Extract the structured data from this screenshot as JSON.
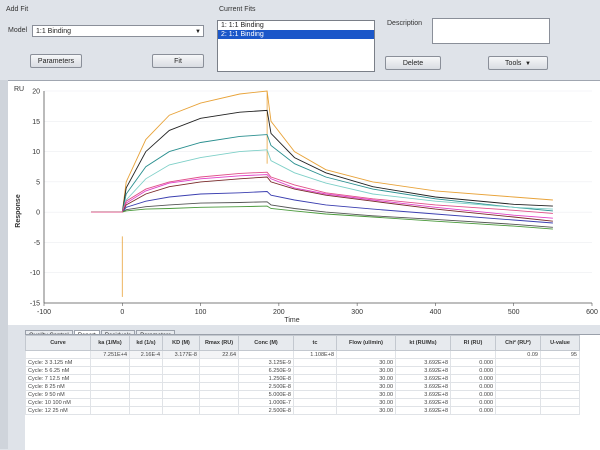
{
  "fit": {
    "add_fit_label": "Add Fit",
    "model_label": "Model",
    "model_value": "1:1 Binding",
    "parameters_button": "Parameters",
    "fit_button": "Fit"
  },
  "current_fits": {
    "title": "Current Fits",
    "items": [
      {
        "label": "1: 1:1 Binding",
        "selected": false
      },
      {
        "label": "2: 1:1 Binding",
        "selected": true
      }
    ],
    "delete_button": "Delete"
  },
  "description": {
    "label": "Description",
    "value": ""
  },
  "tools_button": "Tools",
  "chart_data": {
    "type": "line",
    "ylabel": "Response",
    "xlabel": "Time",
    "unit_label": "RU",
    "xlim": [
      -100,
      600
    ],
    "ylim": [
      -15,
      20
    ],
    "x_ticks": [
      -100,
      0,
      100,
      200,
      300,
      400,
      500,
      600
    ],
    "y_ticks": [
      -15,
      -10,
      -5,
      0,
      5,
      10,
      15,
      20
    ],
    "series": [
      {
        "color": "#e8a33a",
        "points": [
          [
            -40,
            0
          ],
          [
            0,
            0
          ],
          [
            5,
            5
          ],
          [
            30,
            12
          ],
          [
            60,
            16
          ],
          [
            100,
            18
          ],
          [
            150,
            19.5
          ],
          [
            185,
            20
          ],
          [
            190,
            15
          ],
          [
            220,
            10
          ],
          [
            260,
            7
          ],
          [
            320,
            5
          ],
          [
            400,
            3.5
          ],
          [
            500,
            2.5
          ],
          [
            550,
            2
          ]
        ]
      },
      {
        "color": "#222222",
        "points": [
          [
            -40,
            0
          ],
          [
            0,
            0
          ],
          [
            5,
            4
          ],
          [
            30,
            10
          ],
          [
            60,
            13.5
          ],
          [
            100,
            15.5
          ],
          [
            150,
            16.5
          ],
          [
            185,
            16.8
          ],
          [
            190,
            13
          ],
          [
            220,
            9
          ],
          [
            260,
            6.5
          ],
          [
            320,
            4.2
          ],
          [
            400,
            2.5
          ],
          [
            500,
            1.3
          ],
          [
            550,
            1
          ]
        ]
      },
      {
        "color": "#2a8f8f",
        "points": [
          [
            -40,
            0
          ],
          [
            0,
            0
          ],
          [
            5,
            3
          ],
          [
            30,
            7.5
          ],
          [
            60,
            10
          ],
          [
            100,
            11.5
          ],
          [
            150,
            12.5
          ],
          [
            185,
            12.8
          ],
          [
            190,
            11
          ],
          [
            220,
            8
          ],
          [
            260,
            5.8
          ],
          [
            320,
            3.8
          ],
          [
            400,
            2.2
          ],
          [
            500,
            0.8
          ],
          [
            550,
            0.2
          ]
        ]
      },
      {
        "color": "#7fd0c8",
        "points": [
          [
            -40,
            0
          ],
          [
            0,
            0
          ],
          [
            5,
            2
          ],
          [
            30,
            5.5
          ],
          [
            60,
            7.8
          ],
          [
            100,
            9
          ],
          [
            150,
            10
          ],
          [
            185,
            10.3
          ],
          [
            190,
            8.5
          ],
          [
            220,
            6.5
          ],
          [
            260,
            4.8
          ],
          [
            320,
            3
          ],
          [
            400,
            1.8
          ],
          [
            500,
            0.8
          ],
          [
            550,
            0.5
          ]
        ]
      },
      {
        "color": "#e040c8",
        "points": [
          [
            -40,
            0
          ],
          [
            0,
            0
          ],
          [
            5,
            1.5
          ],
          [
            30,
            3.5
          ],
          [
            60,
            4.8
          ],
          [
            100,
            5.5
          ],
          [
            150,
            6
          ],
          [
            185,
            6.2
          ],
          [
            190,
            5.5
          ],
          [
            220,
            4
          ],
          [
            260,
            3
          ],
          [
            320,
            2
          ],
          [
            400,
            0.8
          ],
          [
            500,
            -0.5
          ],
          [
            550,
            -1
          ]
        ]
      },
      {
        "color": "#7a2a2a",
        "points": [
          [
            -40,
            0
          ],
          [
            0,
            0
          ],
          [
            5,
            1.2
          ],
          [
            30,
            3
          ],
          [
            60,
            4.2
          ],
          [
            100,
            5
          ],
          [
            150,
            5.5
          ],
          [
            185,
            5.8
          ],
          [
            190,
            5
          ],
          [
            220,
            3.8
          ],
          [
            260,
            2.8
          ],
          [
            320,
            1.8
          ],
          [
            400,
            0.5
          ],
          [
            500,
            -0.8
          ],
          [
            550,
            -1.5
          ]
        ]
      },
      {
        "color": "#3b3fb0",
        "points": [
          [
            -40,
            0
          ],
          [
            0,
            0
          ],
          [
            5,
            0.8
          ],
          [
            30,
            1.8
          ],
          [
            60,
            2.5
          ],
          [
            100,
            3
          ],
          [
            150,
            3.2
          ],
          [
            185,
            3.4
          ],
          [
            190,
            2.8
          ],
          [
            220,
            2
          ],
          [
            260,
            1.2
          ],
          [
            320,
            0.5
          ],
          [
            400,
            -0.3
          ],
          [
            500,
            -1.3
          ],
          [
            550,
            -1.8
          ]
        ]
      },
      {
        "color": "#555555",
        "points": [
          [
            -40,
            0
          ],
          [
            0,
            0
          ],
          [
            5,
            0.4
          ],
          [
            30,
            0.9
          ],
          [
            60,
            1.2
          ],
          [
            100,
            1.5
          ],
          [
            150,
            1.6
          ],
          [
            185,
            1.7
          ],
          [
            190,
            1.2
          ],
          [
            220,
            0.6
          ],
          [
            260,
            0
          ],
          [
            320,
            -0.6
          ],
          [
            400,
            -1.2
          ],
          [
            500,
            -2
          ],
          [
            550,
            -2.5
          ]
        ]
      },
      {
        "color": "#4b9a3c",
        "points": [
          [
            -40,
            0
          ],
          [
            0,
            0
          ],
          [
            5,
            0.2
          ],
          [
            30,
            0.5
          ],
          [
            60,
            0.6
          ],
          [
            100,
            0.8
          ],
          [
            150,
            0.9
          ],
          [
            185,
            1
          ],
          [
            190,
            0.6
          ],
          [
            220,
            0.2
          ],
          [
            260,
            -0.3
          ],
          [
            320,
            -0.8
          ],
          [
            400,
            -1.5
          ],
          [
            500,
            -2.3
          ],
          [
            550,
            -2.8
          ]
        ]
      },
      {
        "color": "#e0508a",
        "points": [
          [
            -40,
            0
          ],
          [
            0,
            0
          ],
          [
            5,
            1.8
          ],
          [
            30,
            3.8
          ],
          [
            60,
            5
          ],
          [
            100,
            5.8
          ],
          [
            150,
            6.4
          ],
          [
            185,
            6.6
          ],
          [
            190,
            5.8
          ],
          [
            220,
            4.5
          ],
          [
            260,
            3.2
          ],
          [
            320,
            2.2
          ],
          [
            400,
            1.2
          ],
          [
            500,
            0.3
          ],
          [
            550,
            -0.2
          ]
        ]
      }
    ]
  },
  "tabs": [
    {
      "label": "Quality Control",
      "active": false
    },
    {
      "label": "Report",
      "active": true
    },
    {
      "label": "Residuals",
      "active": false
    },
    {
      "label": "Parameters",
      "active": false
    }
  ],
  "table": {
    "headers": [
      "Curve",
      "ka (1/Ms)",
      "kd (1/s)",
      "KD (M)",
      "Rmax (RU)",
      "Conc (M)",
      "tc",
      "Flow (ul/min)",
      "kt (RU/Ms)",
      "RI (RU)",
      "Chi² (RU²)",
      "U-value"
    ],
    "rows": [
      [
        "",
        "7.251E+4",
        "2.16E-4",
        "3.177E-8",
        "22.64",
        "",
        "1.108E+8",
        "",
        "",
        "",
        "0.09",
        "95"
      ],
      [
        "Cycle: 3 3.125 nM",
        "",
        "",
        "",
        "",
        "3.125E-9",
        "",
        "30.00",
        "3.692E+8",
        "0.000",
        "",
        ""
      ],
      [
        "Cycle: 5 6.25 nM",
        "",
        "",
        "",
        "",
        "6.250E-9",
        "",
        "30.00",
        "3.692E+8",
        "0.000",
        "",
        ""
      ],
      [
        "Cycle: 7 12.5 nM",
        "",
        "",
        "",
        "",
        "1.250E-8",
        "",
        "30.00",
        "3.692E+8",
        "0.000",
        "",
        ""
      ],
      [
        "Cycle: 8 25 nM",
        "",
        "",
        "",
        "",
        "2.500E-8",
        "",
        "30.00",
        "3.692E+8",
        "0.000",
        "",
        ""
      ],
      [
        "Cycle: 9 50 nM",
        "",
        "",
        "",
        "",
        "5.000E-8",
        "",
        "30.00",
        "3.692E+8",
        "0.000",
        "",
        ""
      ],
      [
        "Cycle: 10 100 nM",
        "",
        "",
        "",
        "",
        "1.000E-7",
        "",
        "30.00",
        "3.692E+8",
        "0.000",
        "",
        ""
      ],
      [
        "Cycle: 12 25 nM",
        "",
        "",
        "",
        "",
        "2.500E-8",
        "",
        "30.00",
        "3.692E+8",
        "0.000",
        "",
        ""
      ]
    ]
  }
}
